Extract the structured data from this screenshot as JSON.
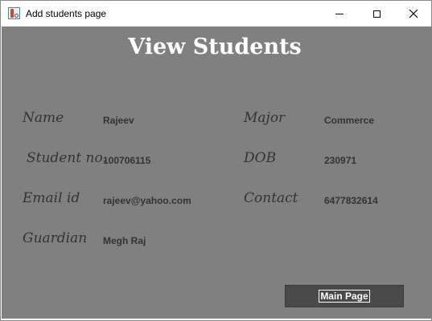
{
  "window": {
    "title": "Add students page",
    "icon": "java-cup-icon"
  },
  "heading": "View Students",
  "fields": {
    "name": {
      "label": "Name",
      "value": "Rajeev"
    },
    "student_no": {
      "label": "Student no.",
      "value": "100706115"
    },
    "email": {
      "label": "Email id",
      "value": "rajeev@yahoo.com"
    },
    "guardian": {
      "label": "Guardian",
      "value": "Megh Raj"
    },
    "major": {
      "label": "Major",
      "value": "Commerce"
    },
    "dob": {
      "label": "DOB",
      "value": "230971"
    },
    "contact": {
      "label": "Contact",
      "value": "6477832614"
    }
  },
  "buttons": {
    "main_page": "Main Page"
  },
  "colors": {
    "background": "#808080",
    "button": "#4a4a4a",
    "heading": "#ffffff",
    "text": "#333333"
  }
}
